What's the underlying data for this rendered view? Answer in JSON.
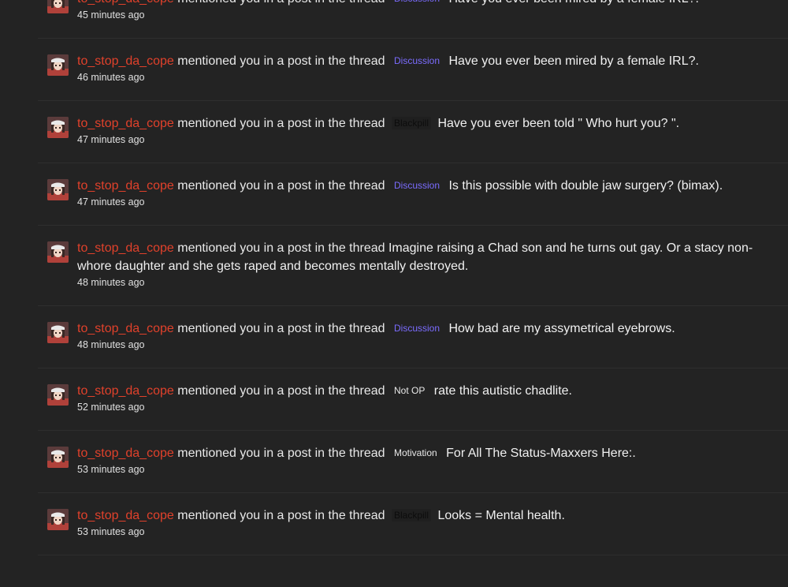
{
  "alert_action": "mentioned you in a post in the thread",
  "colors": {
    "background": "#232323",
    "username": "#e0412b",
    "prefix_discussion": "#7b6cff",
    "prefix_blackpill": "#0c0c0c"
  },
  "alerts": [
    {
      "user": "to_stop_da_cope",
      "prefix": "Discussion",
      "prefix_style": "discussion",
      "title": "Have you ever been mired by a female IRL?.",
      "time": "45 minutes ago"
    },
    {
      "user": "to_stop_da_cope",
      "prefix": "Discussion",
      "prefix_style": "discussion",
      "title": "Have you ever been mired by a female IRL?.",
      "time": "46 minutes ago"
    },
    {
      "user": "to_stop_da_cope",
      "prefix": "Blackpill",
      "prefix_style": "blackpill",
      "title": "Have you ever been told \" Who hurt you? \".",
      "time": "47 minutes ago"
    },
    {
      "user": "to_stop_da_cope",
      "prefix": "Discussion",
      "prefix_style": "discussion",
      "title": "Is this possible with double jaw surgery? (bimax).",
      "time": "47 minutes ago"
    },
    {
      "user": "to_stop_da_cope",
      "prefix": "",
      "prefix_style": "none",
      "title": "Imagine raising a Chad son and he turns out gay. Or a stacy non-whore daughter and she gets raped and becomes mentally destroyed.",
      "time": "48 minutes ago"
    },
    {
      "user": "to_stop_da_cope",
      "prefix": "Discussion",
      "prefix_style": "discussion",
      "title": "How bad are my assymetrical eyebrows.",
      "time": "48 minutes ago"
    },
    {
      "user": "to_stop_da_cope",
      "prefix": "Not OP",
      "prefix_style": "notop",
      "title": "rate this autistic chadlite.",
      "time": "52 minutes ago"
    },
    {
      "user": "to_stop_da_cope",
      "prefix": "Motivation",
      "prefix_style": "motivation",
      "title": "For All The Status-Maxxers Here:.",
      "time": "53 minutes ago"
    },
    {
      "user": "to_stop_da_cope",
      "prefix": "Blackpill",
      "prefix_style": "blackpill",
      "title": "Looks = Mental health.",
      "time": "53 minutes ago"
    }
  ]
}
